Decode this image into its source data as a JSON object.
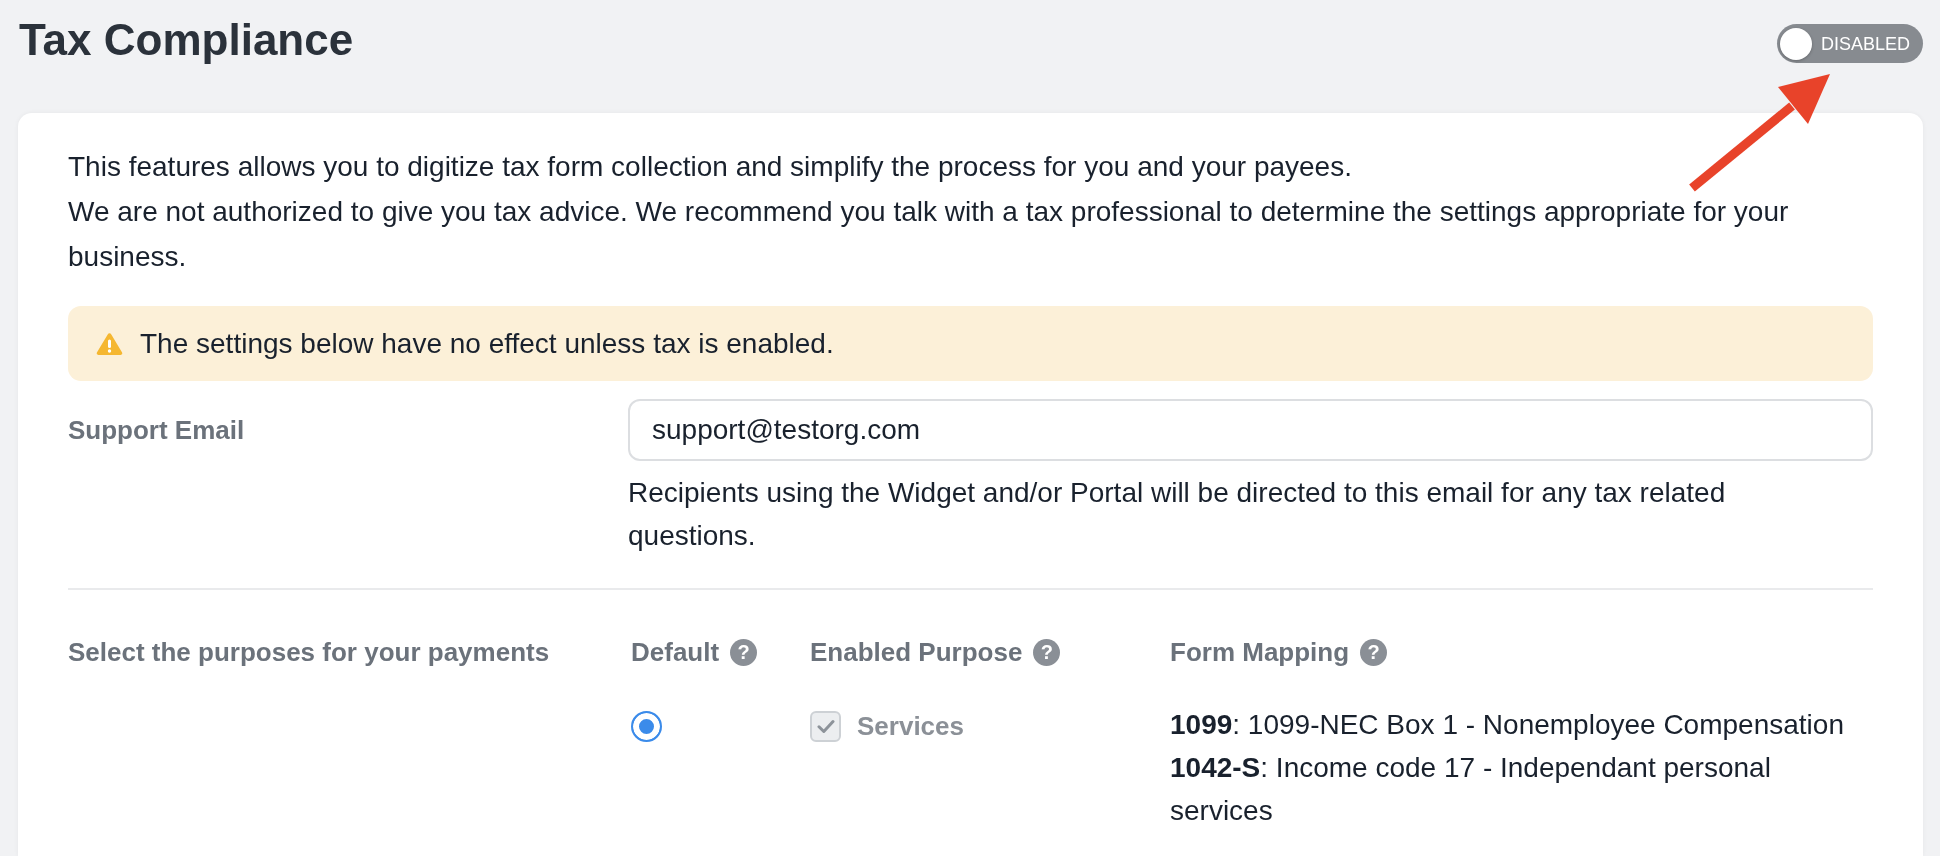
{
  "page": {
    "title": "Tax Compliance"
  },
  "toggle": {
    "label": "DISABLED",
    "on": false
  },
  "intro": [
    "This features allows you to digitize tax form collection and simplify the process for you and your payees.",
    "We are not authorized to give you tax advice. We recommend you talk with a tax professional to determine the settings appropriate for your business."
  ],
  "notice": {
    "kind": "warning",
    "text": "The settings below have no effect unless tax is enabled."
  },
  "support_email": {
    "label": "Support Email",
    "value": "support@testorg.com",
    "help": "Recipients using the Widget and/or Portal will be directed to this email for any tax related questions."
  },
  "purposes": {
    "label": "Select the purposes for your payments",
    "columns": [
      {
        "label": "Default",
        "help_icon": "?"
      },
      {
        "label": "Enabled Purpose",
        "help_icon": "?"
      },
      {
        "label": "Form Mapping",
        "help_icon": "?"
      }
    ],
    "rows": [
      {
        "selected": true,
        "label": "Services",
        "checked": true,
        "disabled": true,
        "mappings": [
          "**1099**: 1099-NEC Box 1 - Nonemployee Compensation",
          "**1042-S**: Income code 17 - Independant personal services"
        ]
      }
    ]
  }
}
